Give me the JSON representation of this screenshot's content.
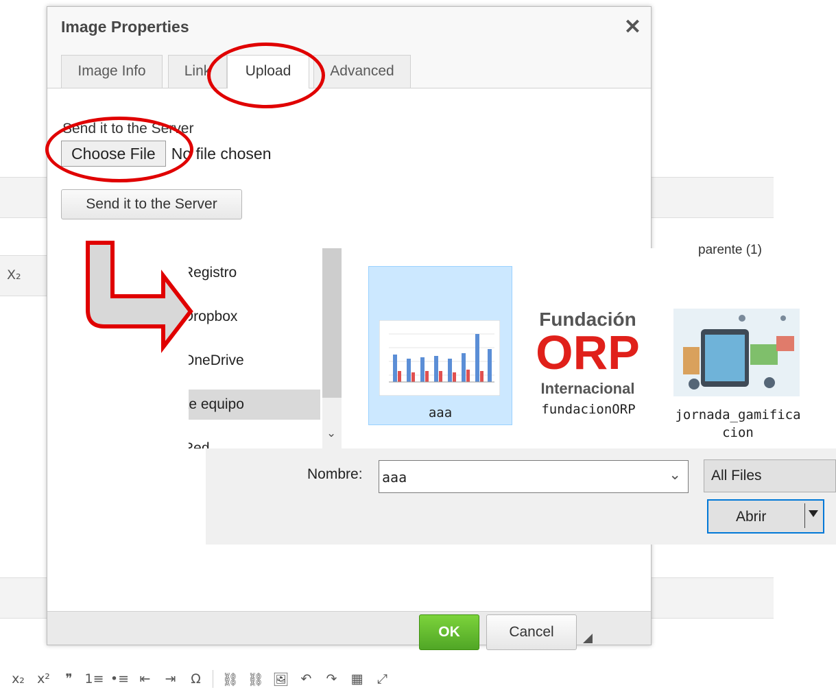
{
  "background": {
    "left_icon": "X₂",
    "toolbar": [
      "x₂",
      "x²",
      "❞",
      "1≡",
      "•≡",
      "⇤",
      "⇥",
      "Ω",
      "⛓",
      "⛓",
      "🖼",
      "↶",
      "↷",
      "▦",
      "⤢"
    ]
  },
  "dialog": {
    "title": "Image Properties",
    "close_label": "✕",
    "tabs": [
      {
        "label": "Image Info"
      },
      {
        "label": "Link"
      },
      {
        "label": "Upload"
      },
      {
        "label": "Advanced"
      }
    ],
    "upload": {
      "label": "Send it to the Server",
      "choose_file_label": "Choose File",
      "no_file_text": "No file chosen",
      "send_button_label": "Send it to the Server"
    },
    "footer": {
      "ok_label": "OK",
      "cancel_label": "Cancel"
    }
  },
  "file_open": {
    "nav_items": [
      {
        "label": "Registro"
      },
      {
        "label": "Dropbox"
      },
      {
        "label": "OneDrive"
      },
      {
        "label": "Este equipo"
      },
      {
        "label": "Red"
      }
    ],
    "cut_label": "parente (1)",
    "files": [
      {
        "name": "aaa"
      },
      {
        "name": "fundacionORP"
      },
      {
        "name": "jornada_gamifica"
      },
      {
        "name": "cion"
      }
    ],
    "logo": {
      "line1": "Fundación",
      "line2": "ORP",
      "line3": "Internacional"
    },
    "name_label": "Nombre:",
    "name_value": "aaa",
    "filter_label": "All Files",
    "open_label": "Abrir"
  },
  "colors": {
    "annotation": "#e00000",
    "ok_green": "#5cb82e",
    "selection": "#cce8ff"
  }
}
